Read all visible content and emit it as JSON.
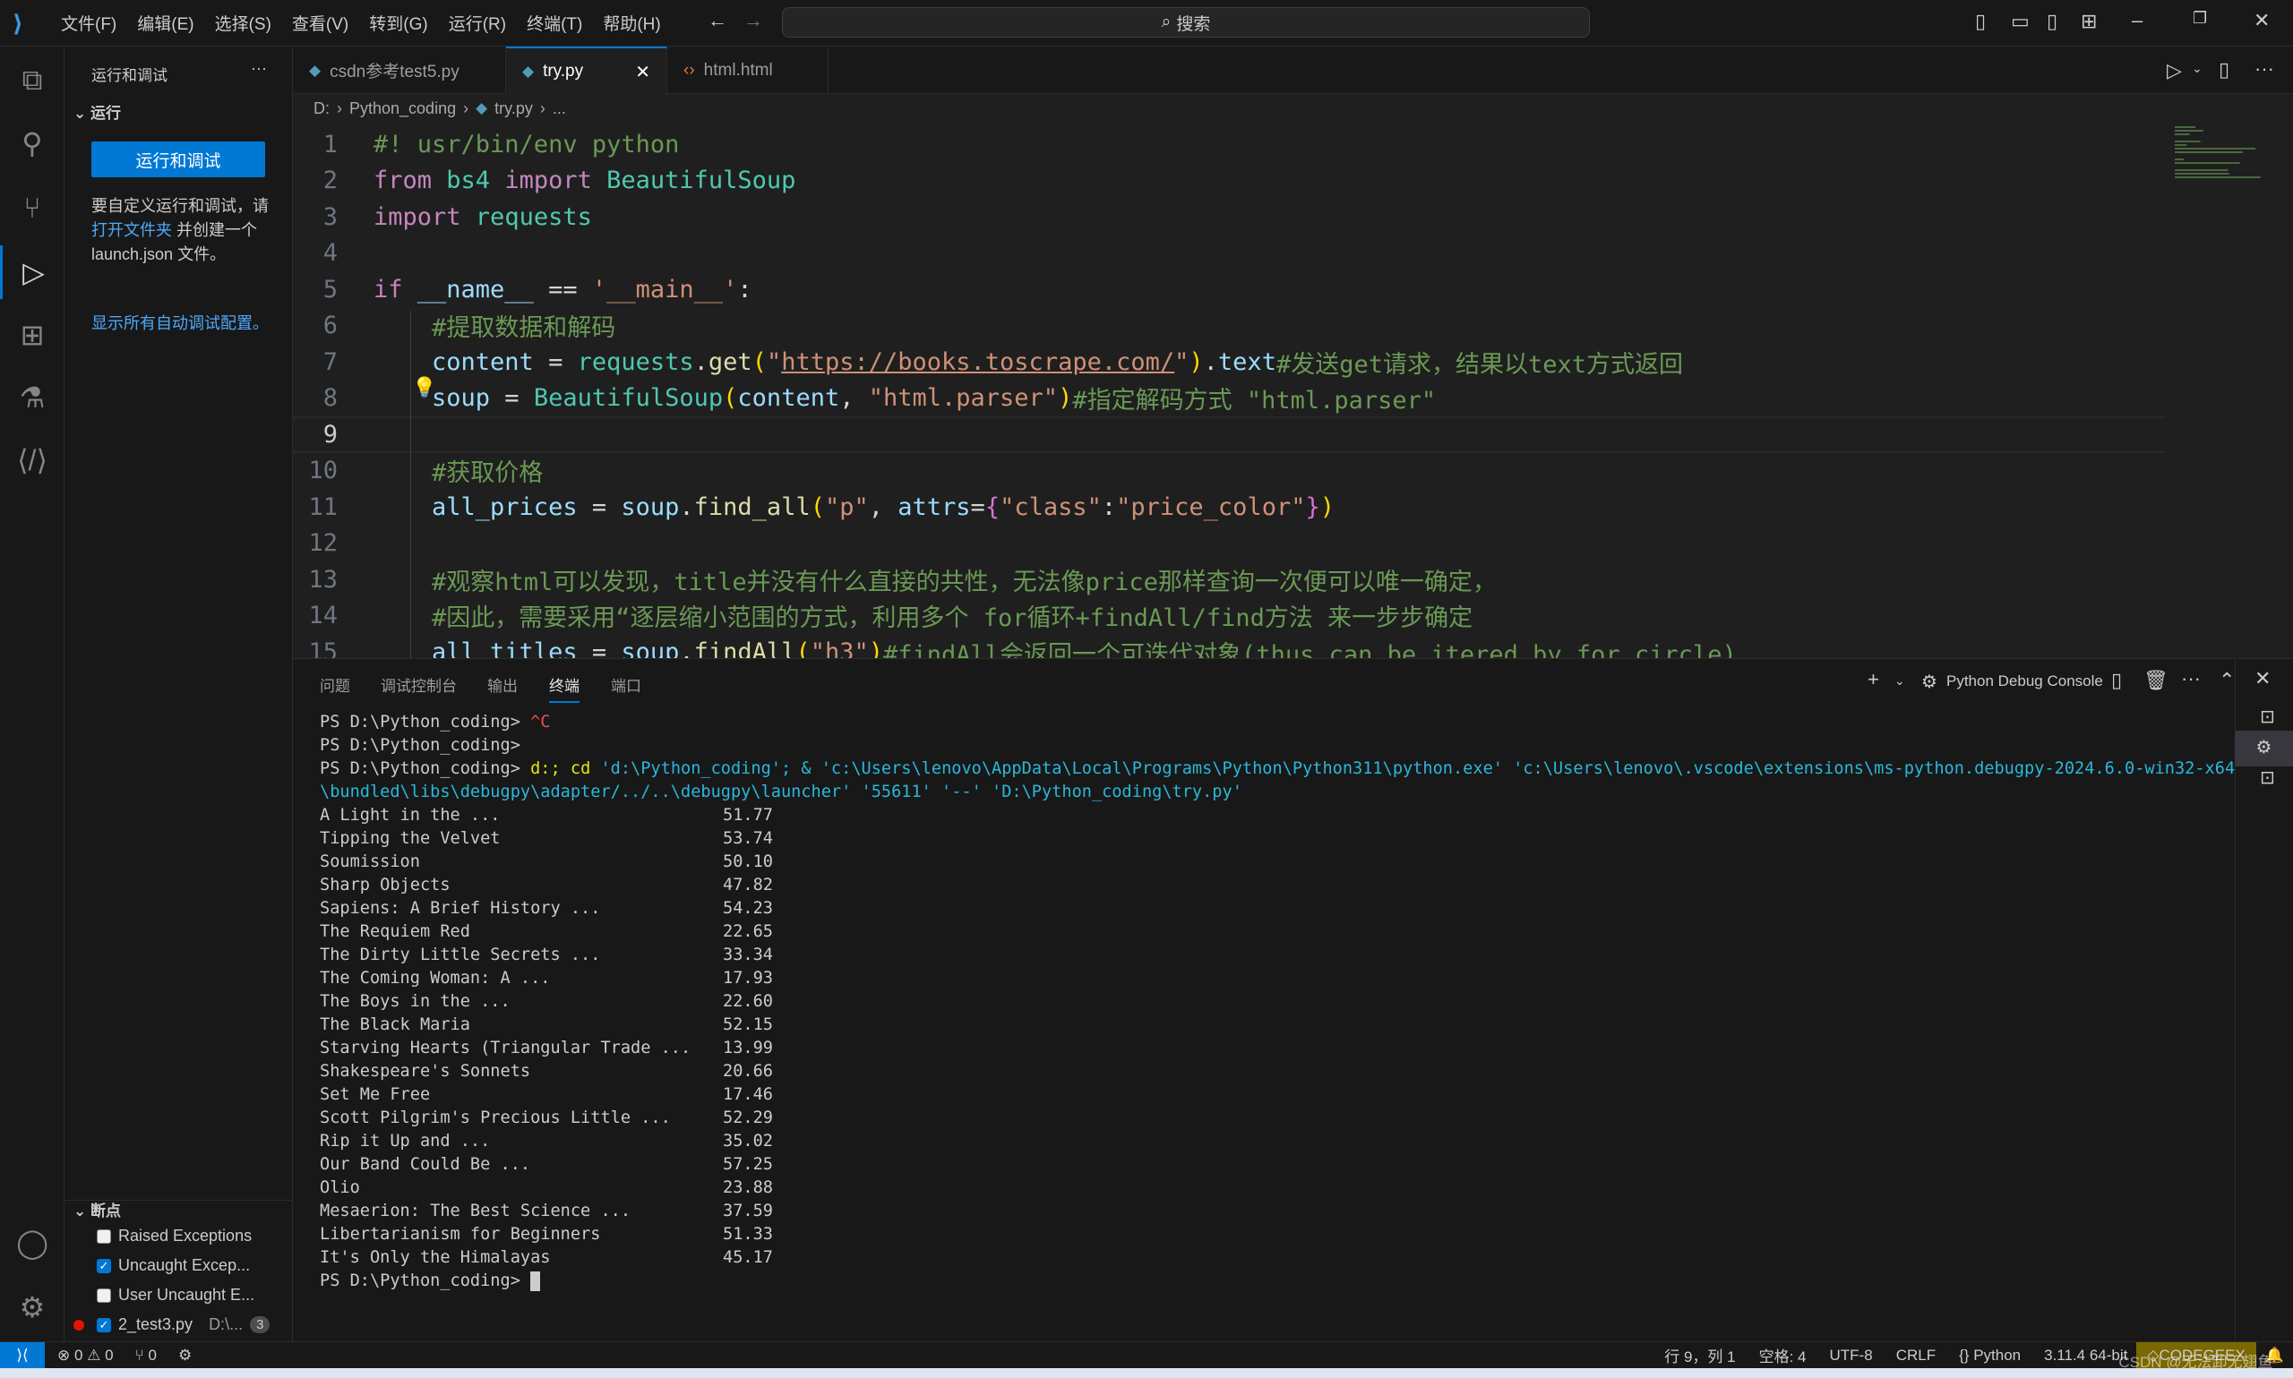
{
  "titlebar": {
    "menu": [
      "文件(F)",
      "编辑(E)",
      "选择(S)",
      "查看(V)",
      "转到(G)",
      "运行(R)",
      "终端(T)",
      "帮助(H)"
    ],
    "search": "搜索"
  },
  "sidebar": {
    "title": "运行和调试",
    "run_section": "运行",
    "run_button": "运行和调试",
    "help_pre": "要自定义运行和调试，请",
    "help_link": "打开文件夹",
    "help_post": " 并创建一个 launch.json 文件。",
    "show_all": "显示所有自动调试配置。",
    "breakpoints_section": "断点",
    "breakpoints": [
      {
        "label": "Raised Exceptions",
        "checked": false
      },
      {
        "label": "Uncaught Excep...",
        "checked": true
      },
      {
        "label": "User Uncaught E...",
        "checked": false
      }
    ],
    "file_bp": {
      "label": "2_test3.py",
      "path": "D:\\...",
      "count": "3",
      "checked": true
    }
  },
  "tabs": [
    {
      "label": "csdn参考test5.py",
      "icon": "python-icon"
    },
    {
      "label": "try.py",
      "icon": "python-icon",
      "active": true
    },
    {
      "label": "html.html",
      "icon": "html-icon"
    }
  ],
  "breadcrumb": [
    "D:",
    "Python_coding",
    "try.py",
    "..."
  ],
  "editor": {
    "current_line": 9,
    "lines": [
      [
        [
          "#! usr/bin/env python",
          "cm"
        ]
      ],
      [
        [
          "from",
          "kw"
        ],
        [
          " bs4 ",
          "cls"
        ],
        [
          "import",
          "kw"
        ],
        [
          " BeautifulSoup",
          "cls"
        ]
      ],
      [
        [
          "import",
          "kw"
        ],
        [
          " requests",
          "cls"
        ]
      ],
      [],
      [
        [
          "if",
          "kw"
        ],
        [
          " __name__",
          "vr"
        ],
        [
          " == ",
          "op"
        ],
        [
          "'__main__'",
          "st"
        ],
        [
          ":",
          "op"
        ]
      ],
      [
        [
          "    #提取数据和解码",
          "cm"
        ]
      ],
      [
        [
          "    content",
          "vr"
        ],
        [
          " = ",
          "op"
        ],
        [
          "requests",
          "cls"
        ],
        [
          ".",
          "op"
        ],
        [
          "get",
          "fn"
        ],
        [
          "(",
          "b1"
        ],
        [
          "\"",
          "st"
        ],
        [
          "https://books.toscrape.com/",
          "url"
        ],
        [
          "\"",
          "st"
        ],
        [
          ")",
          "b1"
        ],
        [
          ".",
          "op"
        ],
        [
          "text",
          "vr"
        ],
        [
          "#发送get请求，结果以text方式返回",
          "cm"
        ]
      ],
      [
        [
          "    soup",
          "vr"
        ],
        [
          " = ",
          "op"
        ],
        [
          "BeautifulSoup",
          "cls"
        ],
        [
          "(",
          "b1"
        ],
        [
          "content",
          "vr"
        ],
        [
          ", ",
          "op"
        ],
        [
          "\"html.parser\"",
          "st"
        ],
        [
          ")",
          "b1"
        ],
        [
          "#指定解码方式 \"html.parser\"",
          "cm"
        ]
      ],
      [],
      [
        [
          "    #获取价格",
          "cm"
        ]
      ],
      [
        [
          "    all_prices",
          "vr"
        ],
        [
          " = ",
          "op"
        ],
        [
          "soup",
          "vr"
        ],
        [
          ".",
          "op"
        ],
        [
          "find_all",
          "fn"
        ],
        [
          "(",
          "b1"
        ],
        [
          "\"p\"",
          "st"
        ],
        [
          ", ",
          "op"
        ],
        [
          "attrs",
          "vr"
        ],
        [
          "=",
          "op"
        ],
        [
          "{",
          "b2"
        ],
        [
          "\"class\"",
          "st"
        ],
        [
          ":",
          "op"
        ],
        [
          "\"price_color\"",
          "st"
        ],
        [
          "}",
          "b2"
        ],
        [
          ")",
          "b1"
        ]
      ],
      [],
      [
        [
          "    #观察html可以发现，title并没有什么直接的共性，无法像price那样查询一次便可以唯一确定，",
          "cm"
        ]
      ],
      [
        [
          "    #因此，需要采用“逐层缩小范围的方式，利用多个 for循环+findAll/find方法 来一步步确定",
          "cm"
        ]
      ],
      [
        [
          "    all_titles",
          "vr"
        ],
        [
          " = ",
          "op"
        ],
        [
          "soup",
          "vr"
        ],
        [
          ".",
          "op"
        ],
        [
          "findAll",
          "fn"
        ],
        [
          "(",
          "b1"
        ],
        [
          "\"h3\"",
          "st"
        ],
        [
          ")",
          "b1"
        ],
        [
          "#findAll会返回一个可迭代对象(thus can be itered by for circle)",
          "cm"
        ]
      ]
    ]
  },
  "panel": {
    "tabs": [
      "问题",
      "调试控制台",
      "输出",
      "终端",
      "端口"
    ],
    "active_tab": "终端",
    "terminal_name": "Python Debug Console",
    "prompt": "PS D:\\Python_coding> ",
    "ctrl_c": "^C",
    "cmd_prefix": "d:; cd",
    "cmd_rest": " 'd:\\Python_coding'; & 'c:\\Users\\lenovo\\AppData\\Local\\Programs\\Python\\Python311\\python.exe' 'c:\\Users\\lenovo\\.vscode\\extensions\\ms-python.debugpy-2024.6.0-win32-x64\\bundled\\libs\\debugpy\\adapter/../..\\debugpy\\launcher' '55611' '--' 'D:\\Python_coding\\try.py'",
    "books": [
      [
        "A Light in the ...",
        "51.77"
      ],
      [
        "Tipping the Velvet",
        "53.74"
      ],
      [
        "Soumission",
        "50.10"
      ],
      [
        "Sharp Objects",
        "47.82"
      ],
      [
        "Sapiens: A Brief History ...",
        "54.23"
      ],
      [
        "The Requiem Red",
        "22.65"
      ],
      [
        "The Dirty Little Secrets ...",
        "33.34"
      ],
      [
        "The Coming Woman: A ...",
        "17.93"
      ],
      [
        "The Boys in the ...",
        "22.60"
      ],
      [
        "The Black Maria",
        "52.15"
      ],
      [
        "Starving Hearts (Triangular Trade ...",
        "13.99"
      ],
      [
        "Shakespeare's Sonnets",
        "20.66"
      ],
      [
        "Set Me Free",
        "17.46"
      ],
      [
        "Scott Pilgrim's Precious Little ...",
        "52.29"
      ],
      [
        "Rip it Up and ...",
        "35.02"
      ],
      [
        "Our Band Could Be ...",
        "57.25"
      ],
      [
        "Olio",
        "23.88"
      ],
      [
        "Mesaerion: The Best Science ...",
        "37.59"
      ],
      [
        "Libertarianism for Beginners",
        "51.33"
      ],
      [
        "It's Only the Himalayas",
        "45.17"
      ]
    ]
  },
  "statusbar": {
    "errors": "0",
    "warnings": "0",
    "ports": "0",
    "position": "行 9，列 1",
    "spaces": "空格: 4",
    "encoding": "UTF-8",
    "eol": "CRLF",
    "language": "Python",
    "interpreter": "3.11.4 64-bit",
    "codegeex": "CODEGEEX",
    "watermark": "CSDN @无法卸无翅鱼"
  },
  "colors": {
    "accent": "#0078d4",
    "codegeex_bg": "#7a6800"
  }
}
